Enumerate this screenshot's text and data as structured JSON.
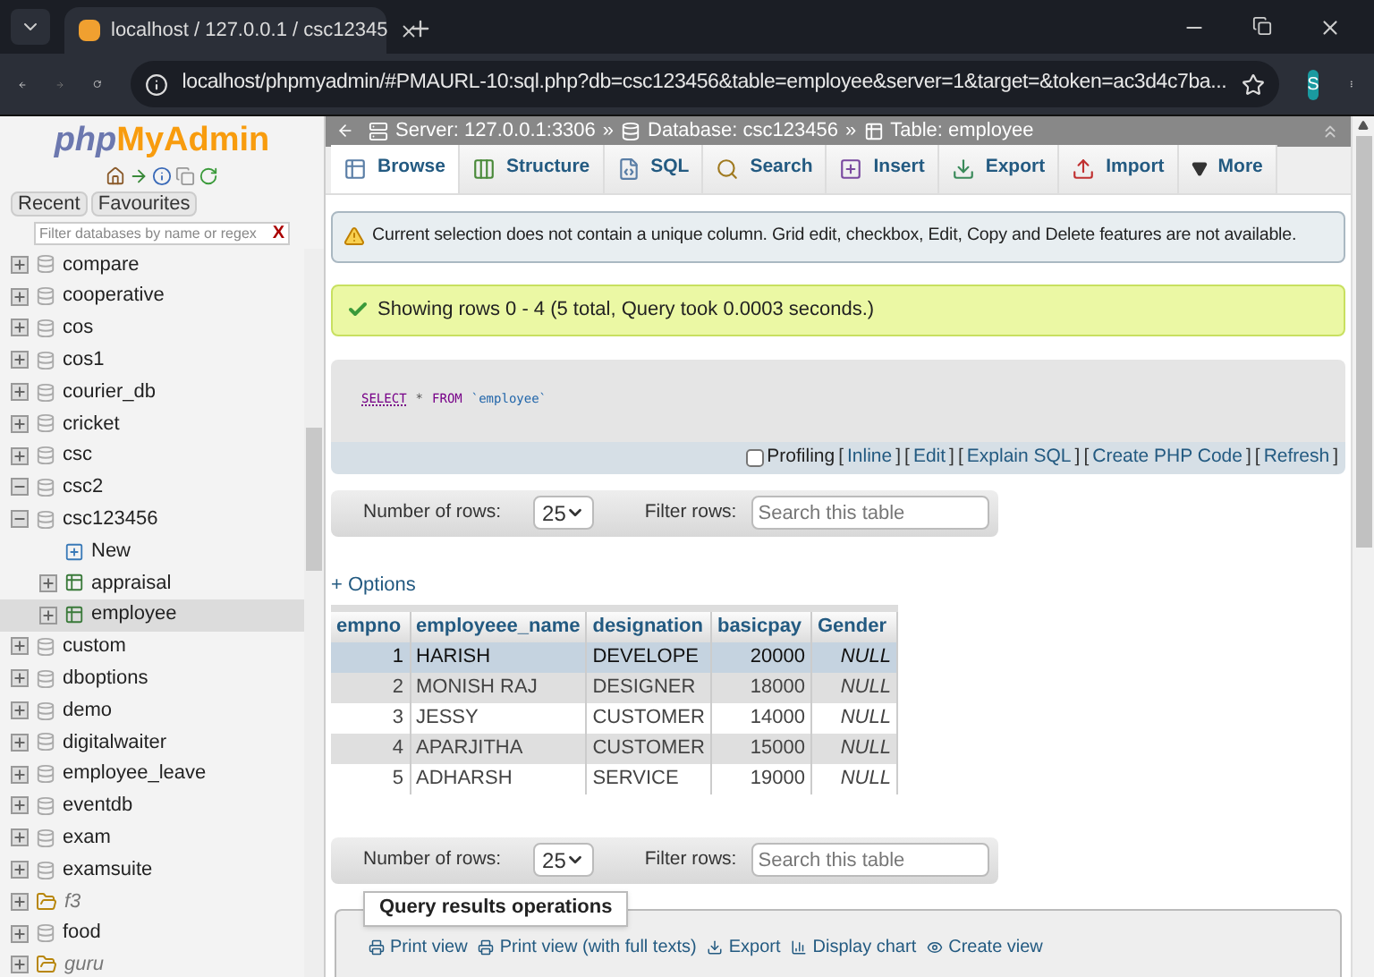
{
  "browser": {
    "tab_title": "localhost / 127.0.0.1 / csc12345",
    "url": "localhost/phpmyadmin/#PMAURL-10:sql.php?db=csc123456&table=employee&server=1&target=&token=ac3d4c7ba...",
    "profile": "S"
  },
  "sidebar": {
    "logo_php": "php",
    "logo_rest": "MyAdmin",
    "tabs": [
      {
        "label": "Recent",
        "selected": false
      },
      {
        "label": "Favourites",
        "selected": false
      }
    ],
    "filter": {
      "placeholder": "Filter databases by name or regex",
      "clear": "X"
    },
    "tree": [
      {
        "name": "compare",
        "kind": "database",
        "expanded": false,
        "selected": false
      },
      {
        "name": "cooperative",
        "kind": "database",
        "expanded": false,
        "selected": false
      },
      {
        "name": "cos",
        "kind": "database",
        "expanded": false,
        "selected": false
      },
      {
        "name": "cos1",
        "kind": "database",
        "expanded": false,
        "selected": false
      },
      {
        "name": "courier_db",
        "kind": "database",
        "expanded": false,
        "selected": false
      },
      {
        "name": "cricket",
        "kind": "database",
        "expanded": false,
        "selected": false
      },
      {
        "name": "csc",
        "kind": "database",
        "expanded": false,
        "selected": false
      },
      {
        "name": "csc2",
        "kind": "database",
        "expanded": true,
        "selected": false
      },
      {
        "name": "csc123456",
        "kind": "database",
        "expanded": true,
        "selected": false,
        "children": [
          {
            "name": "New",
            "kind": "new",
            "selected": false
          },
          {
            "name": "appraisal",
            "kind": "table",
            "expanded": false,
            "selected": false
          },
          {
            "name": "employee",
            "kind": "table",
            "expanded": false,
            "selected": true
          }
        ]
      },
      {
        "name": "custom",
        "kind": "database",
        "expanded": false,
        "selected": false
      },
      {
        "name": "dboptions",
        "kind": "database",
        "expanded": false,
        "selected": false
      },
      {
        "name": "demo",
        "kind": "database",
        "expanded": false,
        "selected": false
      },
      {
        "name": "digitalwaiter",
        "kind": "database",
        "expanded": false,
        "selected": false
      },
      {
        "name": "employee_leave",
        "kind": "database",
        "expanded": false,
        "selected": false
      },
      {
        "name": "eventdb",
        "kind": "database",
        "expanded": false,
        "selected": false
      },
      {
        "name": "exam",
        "kind": "database",
        "expanded": false,
        "selected": false
      },
      {
        "name": "examsuite",
        "kind": "database",
        "expanded": false,
        "selected": false
      },
      {
        "name": "f3",
        "kind": "group",
        "expanded": false,
        "selected": false
      },
      {
        "name": "food",
        "kind": "database",
        "expanded": false,
        "selected": false
      },
      {
        "name": "guru",
        "kind": "group",
        "expanded": false,
        "selected": false
      }
    ]
  },
  "breadcrumb": [
    {
      "kind": "server",
      "label": "Server: 127.0.0.1:3306"
    },
    {
      "kind": "database",
      "label": "Database: csc123456"
    },
    {
      "kind": "table",
      "label": "Table: employee"
    }
  ],
  "breadcrumb_separator": "»",
  "tabs": [
    {
      "label": "Browse",
      "kind": "browse",
      "selected": true
    },
    {
      "label": "Structure",
      "kind": "structure",
      "selected": false
    },
    {
      "label": "SQL",
      "kind": "sql",
      "selected": false
    },
    {
      "label": "Search",
      "kind": "search",
      "selected": false
    },
    {
      "label": "Insert",
      "kind": "insert",
      "selected": false
    },
    {
      "label": "Export",
      "kind": "export",
      "selected": false
    },
    {
      "label": "Import",
      "kind": "import",
      "selected": false
    },
    {
      "label": "More",
      "kind": "more",
      "selected": false
    }
  ],
  "notice": "Current selection does not contain a unique column. Grid edit, checkbox, Edit, Copy and Delete features are not available.",
  "success": "Showing rows 0 - 4 (5 total, Query took 0.0003 seconds.)",
  "sql": {
    "keyword1": "SELECT",
    "star": "*",
    "keyword2": "FROM",
    "table": "`employee`"
  },
  "profiling": {
    "label": "Profiling",
    "checked": false,
    "bracket_open": "[",
    "bracket_close": "]",
    "links": [
      "Inline",
      "Edit",
      "Explain SQL",
      "Create PHP Code",
      "Refresh"
    ]
  },
  "toolbars": [
    {
      "rows_label": "Number of rows:",
      "rows_value": "25",
      "filter_label": "Filter rows:",
      "filter_placeholder": "Search this table"
    },
    {
      "rows_label": "Number of rows:",
      "rows_value": "25",
      "filter_label": "Filter rows:",
      "filter_placeholder": "Search this table"
    }
  ],
  "options_link": "+ Options",
  "table": {
    "columns": [
      "empno",
      "employeee_name",
      "designation",
      "basicpay",
      "Gender"
    ],
    "rows": [
      {
        "cells": [
          "1",
          "HARISH",
          "DEVELOPE",
          "20000",
          "NULL"
        ],
        "selected": true
      },
      {
        "cells": [
          "2",
          "MONISH RAJ",
          "DESIGNER",
          "18000",
          "NULL"
        ],
        "selected": false
      },
      {
        "cells": [
          "3",
          "JESSY",
          "CUSTOMER",
          "14000",
          "NULL"
        ],
        "selected": false
      },
      {
        "cells": [
          "4",
          "APARJITHA",
          "CUSTOMER",
          "15000",
          "NULL"
        ],
        "selected": false
      },
      {
        "cells": [
          "5",
          "ADHARSH",
          "SERVICE",
          "19000",
          "NULL"
        ],
        "selected": false
      }
    ]
  },
  "operations": {
    "title": "Query results operations",
    "links": [
      "Print view",
      "Print view (with full texts)",
      "Export",
      "Display chart",
      "Create view"
    ]
  }
}
